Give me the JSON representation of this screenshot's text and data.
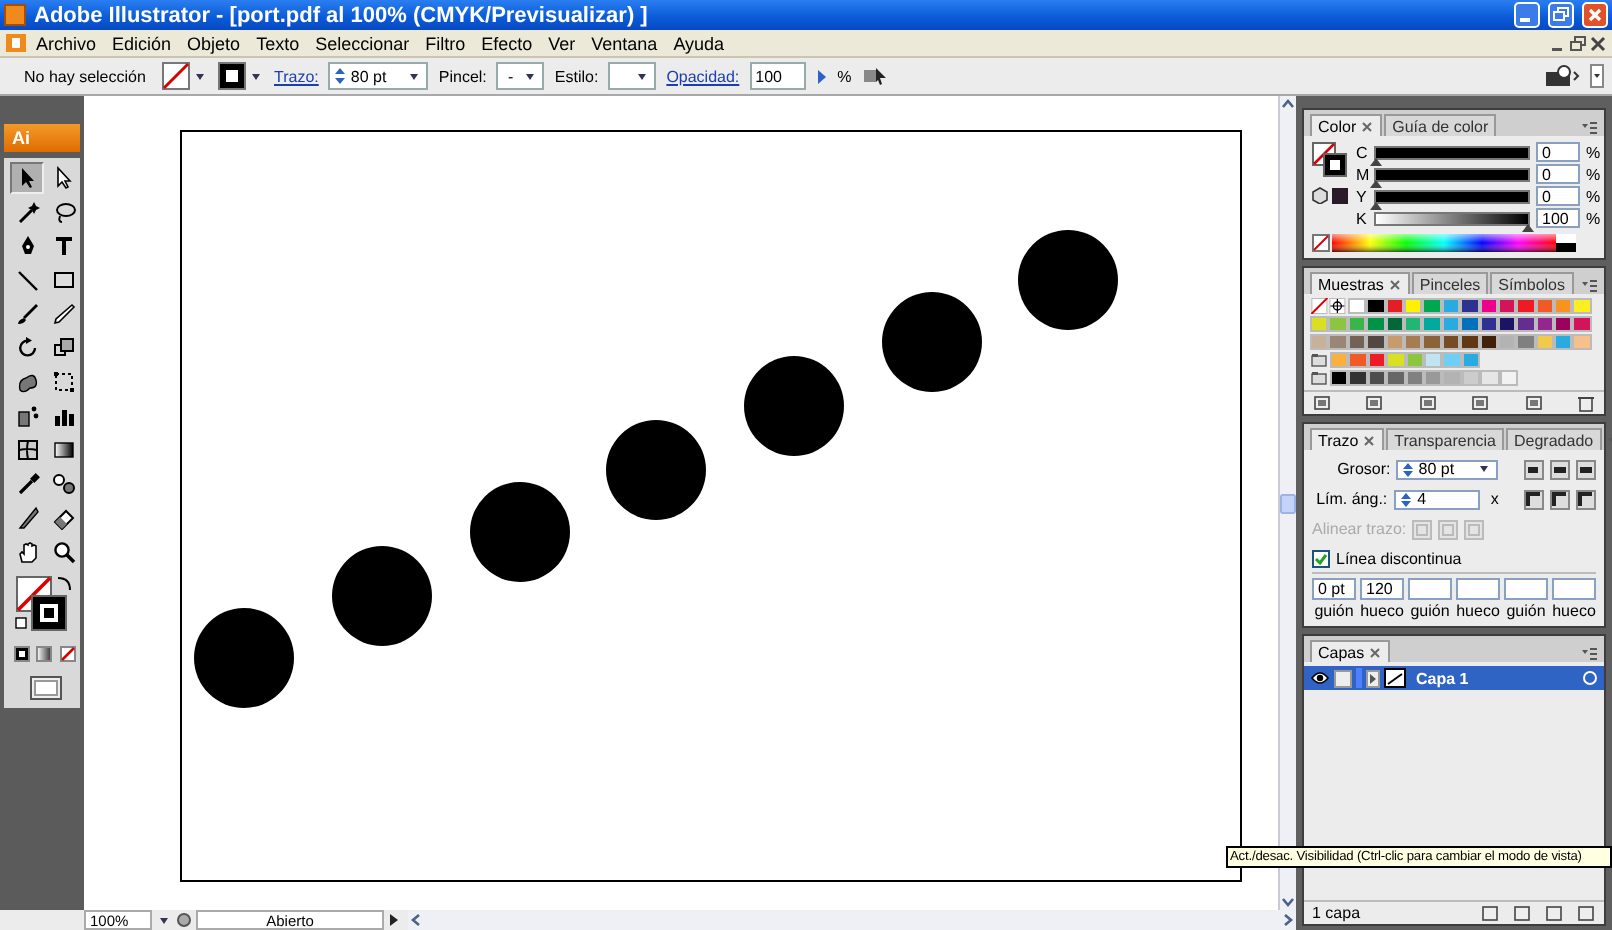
{
  "window": {
    "title": "Adobe Illustrator - [port.pdf al 100% (CMYK/Previsualizar) ]"
  },
  "menu": [
    "Archivo",
    "Edición",
    "Objeto",
    "Texto",
    "Seleccionar",
    "Filtro",
    "Efecto",
    "Ver",
    "Ventana",
    "Ayuda"
  ],
  "control_bar": {
    "selection": "No hay selección",
    "stroke_label": "Trazo:",
    "stroke_weight": "80 pt",
    "brush_label": "Pincel:",
    "brush_value": "-",
    "style_label": "Estilo:",
    "opacity_label": "Opacidad:",
    "opacity_value": "100",
    "opacity_unit": "%"
  },
  "toolbox": {
    "logo": "Ai",
    "tools": [
      {
        "kind": "selection",
        "selected": true
      },
      {
        "kind": "direct-selection",
        "selected": false
      },
      {
        "kind": "magic-wand",
        "selected": false
      },
      {
        "kind": "lasso",
        "selected": false
      },
      {
        "kind": "pen",
        "selected": false
      },
      {
        "kind": "type",
        "selected": false
      },
      {
        "kind": "line",
        "selected": false
      },
      {
        "kind": "rectangle",
        "selected": false
      },
      {
        "kind": "brush",
        "selected": false
      },
      {
        "kind": "pencil",
        "selected": false
      },
      {
        "kind": "rotate",
        "selected": false
      },
      {
        "kind": "scale",
        "selected": false
      },
      {
        "kind": "warp",
        "selected": false
      },
      {
        "kind": "free-transform",
        "selected": false
      },
      {
        "kind": "symbol-sprayer",
        "selected": false
      },
      {
        "kind": "graph",
        "selected": false
      },
      {
        "kind": "mesh",
        "selected": false
      },
      {
        "kind": "gradient",
        "selected": false
      },
      {
        "kind": "eyedropper",
        "selected": false
      },
      {
        "kind": "blend",
        "selected": false
      },
      {
        "kind": "slice",
        "selected": false
      },
      {
        "kind": "eraser",
        "selected": false
      },
      {
        "kind": "hand",
        "selected": false
      },
      {
        "kind": "zoom",
        "selected": false
      }
    ]
  },
  "color_panel": {
    "tabs": [
      {
        "label": "Color",
        "selected": true
      },
      {
        "label": "Guía de color",
        "selected": false
      }
    ],
    "channels": [
      {
        "name": "C",
        "level": 0,
        "value": "0",
        "unit": "%"
      },
      {
        "name": "M",
        "level": 0,
        "value": "0",
        "unit": "%"
      },
      {
        "name": "Y",
        "level": 0,
        "value": "0",
        "unit": "%"
      },
      {
        "name": "K",
        "level": 1,
        "value": "100",
        "unit": "%"
      }
    ]
  },
  "swatches_panel": {
    "tabs": [
      {
        "label": "Muestras",
        "selected": true
      },
      {
        "label": "Pinceles",
        "selected": false
      },
      {
        "label": "Símbolos",
        "selected": false
      }
    ],
    "rows": [
      {
        "group": false,
        "swatches": [
          {
            "kind": "none"
          },
          {
            "kind": "registration"
          },
          {
            "kind": "color",
            "color": "#ffffff"
          },
          {
            "kind": "color",
            "color": "#000000"
          },
          {
            "kind": "color",
            "color": "#e31e24"
          },
          {
            "kind": "color",
            "color": "#fff200"
          },
          {
            "kind": "color",
            "color": "#00a651"
          },
          {
            "kind": "color",
            "color": "#29abe2"
          },
          {
            "kind": "color",
            "color": "#2e3192"
          },
          {
            "kind": "color",
            "color": "#ec008c"
          },
          {
            "kind": "color",
            "color": "#d4145a"
          },
          {
            "kind": "color",
            "color": "#ed1c24"
          },
          {
            "kind": "color",
            "color": "#f15a24"
          },
          {
            "kind": "color",
            "color": "#f7931e"
          },
          {
            "kind": "color",
            "color": "#fcee21"
          }
        ]
      },
      {
        "group": false,
        "swatches": [
          {
            "kind": "color",
            "color": "#d9e021"
          },
          {
            "kind": "color",
            "color": "#8cc63f"
          },
          {
            "kind": "color",
            "color": "#39b54a"
          },
          {
            "kind": "color",
            "color": "#009245"
          },
          {
            "kind": "color",
            "color": "#006837"
          },
          {
            "kind": "color",
            "color": "#22b573"
          },
          {
            "kind": "color",
            "color": "#00a99d"
          },
          {
            "kind": "color",
            "color": "#29abe2"
          },
          {
            "kind": "color",
            "color": "#0071bc"
          },
          {
            "kind": "color",
            "color": "#2e3192"
          },
          {
            "kind": "color",
            "color": "#1b1464"
          },
          {
            "kind": "color",
            "color": "#662d91"
          },
          {
            "kind": "color",
            "color": "#93278f"
          },
          {
            "kind": "color",
            "color": "#9e005d"
          },
          {
            "kind": "color",
            "color": "#d4145a"
          }
        ]
      },
      {
        "group": false,
        "swatches": [
          {
            "kind": "color",
            "color": "#c7b299"
          },
          {
            "kind": "color",
            "color": "#998675"
          },
          {
            "kind": "color",
            "color": "#736357"
          },
          {
            "kind": "color",
            "color": "#534741"
          },
          {
            "kind": "color",
            "color": "#c69c6d"
          },
          {
            "kind": "color",
            "color": "#a67c52"
          },
          {
            "kind": "color",
            "color": "#8c6239"
          },
          {
            "kind": "color",
            "color": "#754c24"
          },
          {
            "kind": "color",
            "color": "#603813"
          },
          {
            "kind": "color",
            "color": "#42210b"
          },
          {
            "kind": "color",
            "color": "#b3b3b3"
          },
          {
            "kind": "color",
            "color": "#808080"
          },
          {
            "kind": "color",
            "color": "#f2c94c"
          },
          {
            "kind": "color",
            "color": "#29abe2"
          },
          {
            "kind": "color",
            "color": "#f7c08a"
          }
        ]
      },
      {
        "group": true,
        "swatches": [
          {
            "kind": "color",
            "color": "#fbb03b"
          },
          {
            "kind": "color",
            "color": "#f15a24"
          },
          {
            "kind": "color",
            "color": "#ed1c24"
          },
          {
            "kind": "color",
            "color": "#d9e021"
          },
          {
            "kind": "color",
            "color": "#8cc63f"
          },
          {
            "kind": "color",
            "color": "#c1e4f3"
          },
          {
            "kind": "color",
            "color": "#6dcff6"
          },
          {
            "kind": "color",
            "color": "#29abe2"
          }
        ]
      },
      {
        "group": true,
        "swatches": [
          {
            "kind": "color",
            "color": "#000000"
          },
          {
            "kind": "color",
            "color": "#333333"
          },
          {
            "kind": "color",
            "color": "#4d4d4d"
          },
          {
            "kind": "color",
            "color": "#666666"
          },
          {
            "kind": "color",
            "color": "#808080"
          },
          {
            "kind": "color",
            "color": "#999999"
          },
          {
            "kind": "color",
            "color": "#b3b3b3"
          },
          {
            "kind": "color",
            "color": "#cccccc"
          },
          {
            "kind": "color",
            "color": "#e6e6e6"
          },
          {
            "kind": "color",
            "color": "#f2f2f2"
          }
        ]
      }
    ]
  },
  "stroke_panel": {
    "tabs": [
      {
        "label": "Trazo",
        "selected": true
      },
      {
        "label": "Transparencia",
        "selected": false
      },
      {
        "label": "Degradado",
        "selected": false
      }
    ],
    "weight_label": "Grosor:",
    "weight": "80 pt",
    "miter_label": "Lím. áng.:",
    "miter": "4",
    "miter_unit": "x",
    "align_label": "Alinear trazo:",
    "align_disabled": true,
    "dashed": {
      "label": "Línea discontinua",
      "checked": true
    },
    "dash_fields": [
      {
        "value": "0 pt",
        "label": "guión"
      },
      {
        "value": "120",
        "label": "hueco"
      },
      {
        "label": "guión"
      },
      {
        "label": "hueco"
      },
      {
        "label": "guión"
      },
      {
        "label": "hueco"
      }
    ]
  },
  "layers_panel": {
    "tabs": [
      {
        "label": "Capas",
        "selected": true
      }
    ],
    "layers": [
      {
        "name": "Capa 1",
        "visible": true,
        "selected": true
      }
    ],
    "count": "1 capa"
  },
  "status_bar": {
    "zoom": "100%",
    "state": "Abierto"
  },
  "tooltip": "Act./desac. Visibilidad (Ctrl-clic para cambiar el modo de vista)"
}
